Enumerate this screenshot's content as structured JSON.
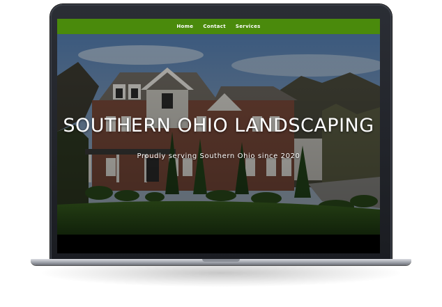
{
  "nav": {
    "items": [
      "Home",
      "Contact",
      "Services"
    ],
    "color": "#4a8a0c"
  },
  "hero": {
    "title": "SOUTHERN OHIO LANDSCAPING",
    "subtitle": "Proudly serving Southern Ohio since 2020"
  }
}
